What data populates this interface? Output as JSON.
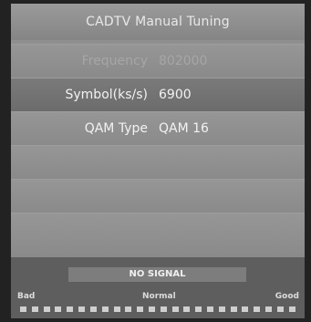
{
  "window": {
    "title": "CADTV Manual Tuning"
  },
  "fields": [
    {
      "label": "Frequency",
      "value": "802000",
      "state": "disabled"
    },
    {
      "label": "Symbol(ks/s)",
      "value": "6900",
      "state": "selected"
    },
    {
      "label": "QAM Type",
      "value": "QAM 16",
      "state": "normal"
    }
  ],
  "signal": {
    "status": "NO SIGNAL",
    "levels": {
      "bad": "Bad",
      "normal": "Normal",
      "good": "Good"
    },
    "meter_segments": 24
  }
}
